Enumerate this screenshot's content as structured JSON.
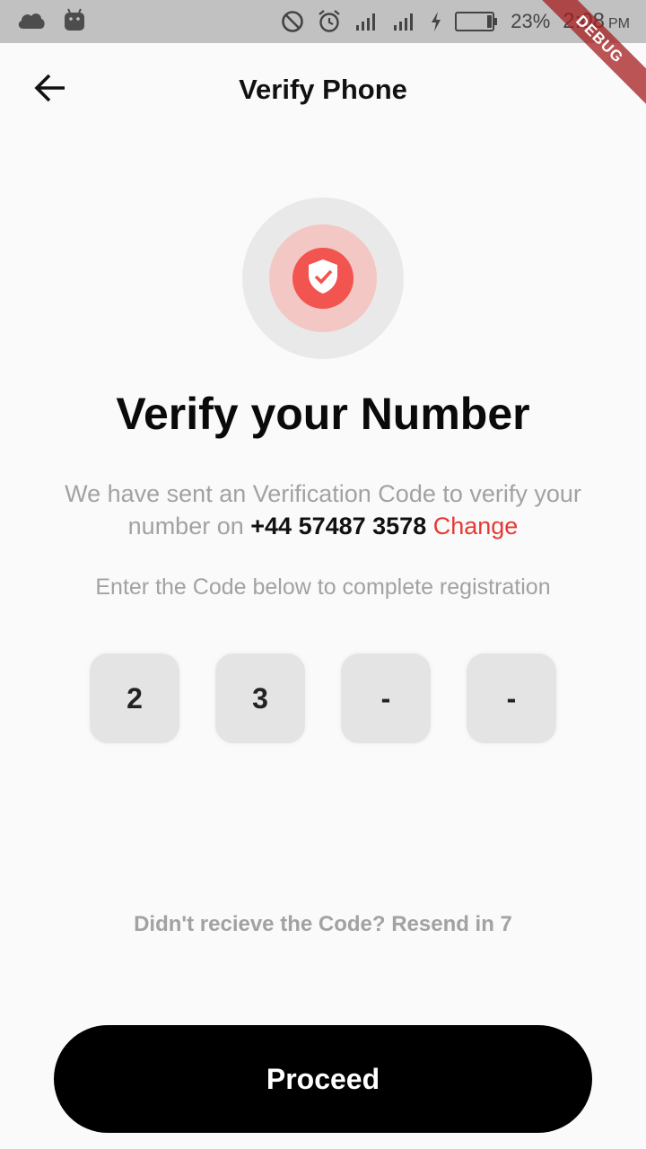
{
  "status_bar": {
    "battery_percent": "23%",
    "time": "2:08",
    "time_suffix": "PM",
    "debug_label": "DEBUG"
  },
  "app_bar": {
    "title": "Verify Phone",
    "back_icon": "arrow-back-icon"
  },
  "badge": {
    "icon": "shield-check-icon",
    "colors": {
      "outer": "#e9e9e9",
      "mid": "#f3c7c4",
      "inner": "#f2544f"
    }
  },
  "content": {
    "heading": "Verify your Number",
    "info_prefix": "We have sent an Verification Code to verify your number on",
    "phone_number": "+44 57487 3578",
    "change_label": "Change",
    "instruction": "Enter the Code below to complete registration"
  },
  "code": {
    "digits": [
      "2",
      "3",
      "-",
      "-"
    ]
  },
  "resend_text": "Didn't recieve the Code? Resend in 7",
  "proceed_label": "Proceed",
  "accent_color": "#e53935"
}
